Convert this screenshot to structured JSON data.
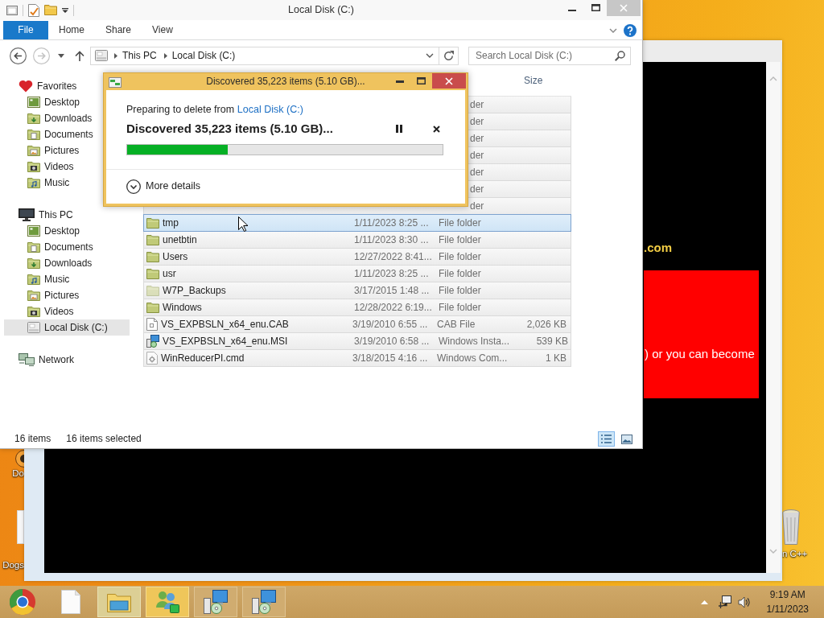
{
  "explorer": {
    "title": "Local Disk (C:)",
    "file_tab": "File",
    "tabs": [
      "Home",
      "Share",
      "View"
    ],
    "breadcrumb": [
      "This PC",
      "Local Disk (C:)"
    ],
    "search": {
      "placeholder": "Search Local Disk (C:)"
    },
    "nav": [
      {
        "label": "Favorites",
        "kind": "favorites",
        "selected": false,
        "children": [
          {
            "label": "Desktop",
            "kind": "desktop",
            "selected": false
          },
          {
            "label": "Downloads",
            "kind": "downloads",
            "selected": false
          },
          {
            "label": "Documents",
            "kind": "documents",
            "selected": false
          },
          {
            "label": "Pictures",
            "kind": "pictures",
            "selected": false
          },
          {
            "label": "Videos",
            "kind": "videos",
            "selected": false
          },
          {
            "label": "Music",
            "kind": "music",
            "selected": false
          }
        ]
      },
      {
        "label": "This PC",
        "kind": "pc",
        "selected": false,
        "children": [
          {
            "label": "Desktop",
            "kind": "desktop",
            "selected": false
          },
          {
            "label": "Documents",
            "kind": "documents",
            "selected": false
          },
          {
            "label": "Downloads",
            "kind": "downloads",
            "selected": false
          },
          {
            "label": "Music",
            "kind": "music",
            "selected": false
          },
          {
            "label": "Pictures",
            "kind": "pictures",
            "selected": false
          },
          {
            "label": "Videos",
            "kind": "videos",
            "selected": false
          },
          {
            "label": "Local Disk (C:)",
            "kind": "drive",
            "selected": true
          }
        ]
      },
      {
        "label": "Network",
        "kind": "network",
        "selected": false
      }
    ],
    "table": {
      "columns": [
        "Size"
      ],
      "rows": [
        {
          "column_3": "der",
          "selected": true,
          "hovered": false
        },
        {
          "column_3": "der",
          "selected": true,
          "hovered": false
        },
        {
          "column_3": "der",
          "selected": true,
          "hovered": false
        },
        {
          "column_3": "der",
          "selected": true,
          "hovered": false
        },
        {
          "column_3": "der",
          "selected": true,
          "hovered": false
        },
        {
          "column_3": "der",
          "selected": true,
          "hovered": false
        },
        {
          "column_3": "der",
          "selected": true,
          "hovered": false
        },
        {
          "kind": "folder",
          "hidden": false,
          "column_1": "tmp",
          "column_2": "1/11/2023 8:25 ...",
          "column_3": "File folder",
          "selected": true,
          "hovered": true
        },
        {
          "kind": "folder",
          "hidden": false,
          "column_1": "unetbtin",
          "column_2": "1/11/2023 8:30 ...",
          "column_3": "File folder",
          "selected": true,
          "hovered": false
        },
        {
          "kind": "folder",
          "hidden": false,
          "column_1": "Users",
          "column_2": "12/27/2022 8:41...",
          "column_3": "File folder",
          "selected": true,
          "hovered": false
        },
        {
          "kind": "folder",
          "hidden": false,
          "column_1": "usr",
          "column_2": "1/11/2023 8:25 ...",
          "column_3": "File folder",
          "selected": true,
          "hovered": false
        },
        {
          "kind": "folder",
          "hidden": true,
          "column_1": "W7P_Backups",
          "column_2": "3/17/2015 1:48 ...",
          "column_3": "File folder",
          "selected": true,
          "hovered": false
        },
        {
          "kind": "folder",
          "hidden": false,
          "column_1": "Windows",
          "column_2": "12/28/2022 6:19...",
          "column_3": "File folder",
          "selected": true,
          "hovered": false
        },
        {
          "kind": "cab",
          "hidden": false,
          "column_1": "VS_EXPBSLN_x64_enu.CAB",
          "column_2": "3/19/2010 6:55 ...",
          "column_3": "CAB File",
          "size": "2,026 KB",
          "selected": true,
          "hovered": false
        },
        {
          "kind": "msi",
          "hidden": false,
          "column_1": "VS_EXPBSLN_x64_enu.MSI",
          "column_2": "3/19/2010 6:58 ...",
          "column_3": "Windows Insta...",
          "size": "539 KB",
          "selected": true,
          "hovered": false
        },
        {
          "kind": "cmd",
          "hidden": false,
          "column_1": "WinReducerPI.cmd",
          "column_2": "3/18/2015 4:16 ...",
          "column_3": "Windows Com...",
          "size": "1 KB",
          "selected": true,
          "hovered": false
        }
      ]
    },
    "status_bar": {
      "items": "16 items",
      "selection": "16 items selected",
      "views": [
        {
          "kind": "details",
          "selected": true
        },
        {
          "kind": "large_icons",
          "selected": false
        }
      ]
    }
  },
  "delete_dialog": {
    "title": "Discovered 35,223 items (5.10 GB)...",
    "message": "Preparing to delete from",
    "location": "Local Disk (C:)",
    "status": "Discovered 35,223 items (5.10 GB)...",
    "progress": {
      "level": 0.32
    },
    "details_label": "More details"
  },
  "background_window": {
    "domain_fragment": ".com",
    "banner_text": ") or you can become"
  },
  "desktop_icons": [
    {
      "kind": "app",
      "label": "Do"
    },
    {
      "kind": "file",
      "label": "Dogs"
    },
    {
      "kind": "recycle_bin",
      "label": "n C++"
    }
  ],
  "taskbar": {
    "items": [
      {
        "kind": "browser",
        "open": false,
        "active": false,
        "flashing": false
      },
      {
        "kind": "document",
        "open": false,
        "active": false,
        "flashing": false
      },
      {
        "kind": "explorer",
        "open": true,
        "active": true,
        "flashing": false
      },
      {
        "kind": "people",
        "open": true,
        "active": false,
        "flashing": true
      },
      {
        "kind": "setup",
        "open": true,
        "active": false,
        "flashing": false
      },
      {
        "kind": "setup",
        "open": true,
        "active": false,
        "flashing": false
      }
    ],
    "clock": {
      "time": "9:19 AM",
      "date": "1/11/2023"
    }
  }
}
